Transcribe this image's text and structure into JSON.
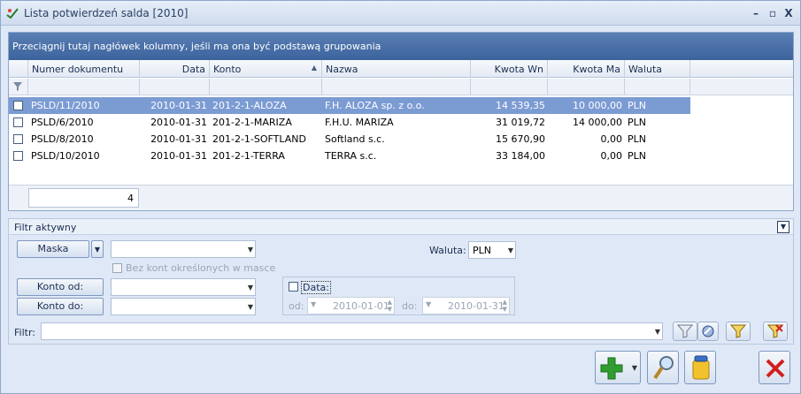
{
  "window": {
    "title": "Lista potwierdzeń salda [2010]",
    "min": "–",
    "max": "▫",
    "close": "X"
  },
  "grid": {
    "group_hint": "Przeciągnij tutaj nagłówek kolumny, jeśli ma ona być podstawą grupowania",
    "columns": [
      "Numer dokumentu",
      "Data",
      "Konto",
      "Nazwa",
      "Kwota Wn",
      "Kwota Ma",
      "Waluta"
    ],
    "sort_column": "Konto",
    "rows": [
      {
        "numer": "PSLD/11/2010",
        "data": "2010-01-31",
        "konto": "201-2-1-ALOZA",
        "nazwa": "F.H. ALOZA sp. z o.o.",
        "wn": "14 539,35",
        "ma": "10 000,00",
        "waluta": "PLN",
        "selected": true
      },
      {
        "numer": "PSLD/6/2010",
        "data": "2010-01-31",
        "konto": "201-2-1-MARIZA",
        "nazwa": "F.H.U. MARIZA",
        "wn": "31 019,72",
        "ma": "14 000,00",
        "waluta": "PLN",
        "selected": false
      },
      {
        "numer": "PSLD/8/2010",
        "data": "2010-01-31",
        "konto": "201-2-1-SOFTLAND",
        "nazwa": "Softland s.c.",
        "wn": "15 670,90",
        "ma": "0,00",
        "waluta": "PLN",
        "selected": false
      },
      {
        "numer": "PSLD/10/2010",
        "data": "2010-01-31",
        "konto": "201-2-1-TERRA",
        "nazwa": "TERRA s.c.",
        "wn": "33 184,00",
        "ma": "0,00",
        "waluta": "PLN",
        "selected": false
      }
    ],
    "count": "4"
  },
  "filter": {
    "title": "Filtr aktywny",
    "maska_label": "Maska",
    "bez_kont_label": "Bez kont określonych w masce",
    "waluta_label": "Waluta:",
    "waluta_value": "PLN",
    "konto_od_label": "Konto od:",
    "konto_do_label": "Konto do:",
    "data_label": "Data:",
    "od_label": "od:",
    "od_value": "2010-01-01",
    "do_label": "do:",
    "do_value": "2010-01-31",
    "filtr_label": "Filtr:"
  },
  "colors": {
    "accent": "#3c639c",
    "selection": "#7b9bd3",
    "add": "#2f9e2f",
    "close": "#d11f1f"
  }
}
